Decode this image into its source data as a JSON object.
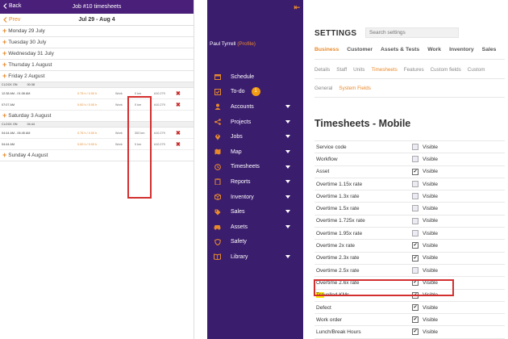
{
  "mobile": {
    "back_label": "Back",
    "title": "Job #10 timesheets",
    "prev_label": "Prev",
    "date_range": "Jul 29 - Aug 4",
    "days": [
      "Monday 29 July",
      "Tuesday 30 July",
      "Wednesday 31 July",
      "Thursday 1 August",
      "Friday 2 August",
      "Saturday 3 August",
      "Sunday 4 August"
    ],
    "clock_label": "CLOCK ON",
    "friday": {
      "clock_time": "00:38",
      "entries": [
        {
          "time": "12:38 AM - 01:08 AM",
          "hours": "0.75 h / 0.00 h",
          "category": "Work",
          "distance": "0 km",
          "code": "#10.279"
        },
        {
          "time": "07:07 AM",
          "hours": "0.00 h / 0.00 h",
          "category": "Work",
          "distance": "0 km",
          "code": "#10.279"
        }
      ]
    },
    "saturday": {
      "clock_time": "04:44",
      "entries": [
        {
          "time": "04:44 AM - 06:45 AM",
          "hours": "0.75 h / 0.00 h",
          "category": "Work",
          "distance": "300 km",
          "code": "#10.279"
        },
        {
          "time": "04:44 AM",
          "hours": "0.00 h / 0.00 h",
          "category": "Work",
          "distance": "0 km",
          "code": "#10.279"
        }
      ]
    }
  },
  "sidebar": {
    "user_name": "Paul Tyrrell",
    "profile_label": "(Profile)",
    "todo_badge": "1",
    "items": [
      {
        "label": "Schedule",
        "icon": "calendar-icon",
        "caret": false
      },
      {
        "label": "To-do",
        "icon": "checklist-icon",
        "caret": false
      },
      {
        "label": "Accounts",
        "icon": "user-icon",
        "caret": true
      },
      {
        "label": "Projects",
        "icon": "share-icon",
        "caret": true
      },
      {
        "label": "Jobs",
        "icon": "map-pin-icon",
        "caret": true
      },
      {
        "label": "Map",
        "icon": "map-icon",
        "caret": true
      },
      {
        "label": "Timesheets",
        "icon": "clock-icon",
        "caret": true
      },
      {
        "label": "Reports",
        "icon": "clipboard-icon",
        "caret": true
      },
      {
        "label": "Inventory",
        "icon": "box-icon",
        "caret": true
      },
      {
        "label": "Sales",
        "icon": "tag-icon",
        "caret": true
      },
      {
        "label": "Assets",
        "icon": "car-icon",
        "caret": true
      },
      {
        "label": "Safety",
        "icon": "shield-icon",
        "caret": false
      },
      {
        "label": "Library",
        "icon": "book-icon",
        "caret": true
      }
    ]
  },
  "settings": {
    "title": "SETTINGS",
    "search_placeholder": "Search settings",
    "tabs_primary": [
      "Business",
      "Customer",
      "Assets & Tests",
      "Work",
      "Inventory",
      "Sales"
    ],
    "tabs_secondary": [
      "Details",
      "Staff",
      "Units",
      "Timesheets",
      "Features",
      "Custom fields",
      "Custom"
    ],
    "tabs_tertiary": [
      "General",
      "System Fields"
    ],
    "section_title": "Timesheets - Mobile",
    "visible_label": "Visible",
    "rows": [
      {
        "label": "Service code",
        "checked": false
      },
      {
        "label": "Workflow",
        "checked": false
      },
      {
        "label": "Asset",
        "checked": true
      },
      {
        "label": "Overtime 1.15x rate",
        "checked": false
      },
      {
        "label": "Overtime 1.3x rate",
        "checked": false
      },
      {
        "label": "Overtime 1.5x rate",
        "checked": false
      },
      {
        "label": "Overtime 1.725x rate",
        "checked": false
      },
      {
        "label": "Overtime 1.95x rate",
        "checked": false
      },
      {
        "label": "Overtime 2x rate",
        "checked": true
      },
      {
        "label": "Overtime 2.3x rate",
        "checked": true
      },
      {
        "label": "Overtime 2.5x rate",
        "checked": false
      },
      {
        "label": "Overtime 2.6x rate",
        "checked": true
      },
      {
        "label": "Travelled KMs",
        "checked": true
      },
      {
        "label": "Defect",
        "checked": true
      },
      {
        "label": "Work order",
        "checked": true
      },
      {
        "label": "Lunch/Break Hours",
        "checked": true
      },
      {
        "label": "Included travel hours",
        "checked": true
      }
    ]
  }
}
